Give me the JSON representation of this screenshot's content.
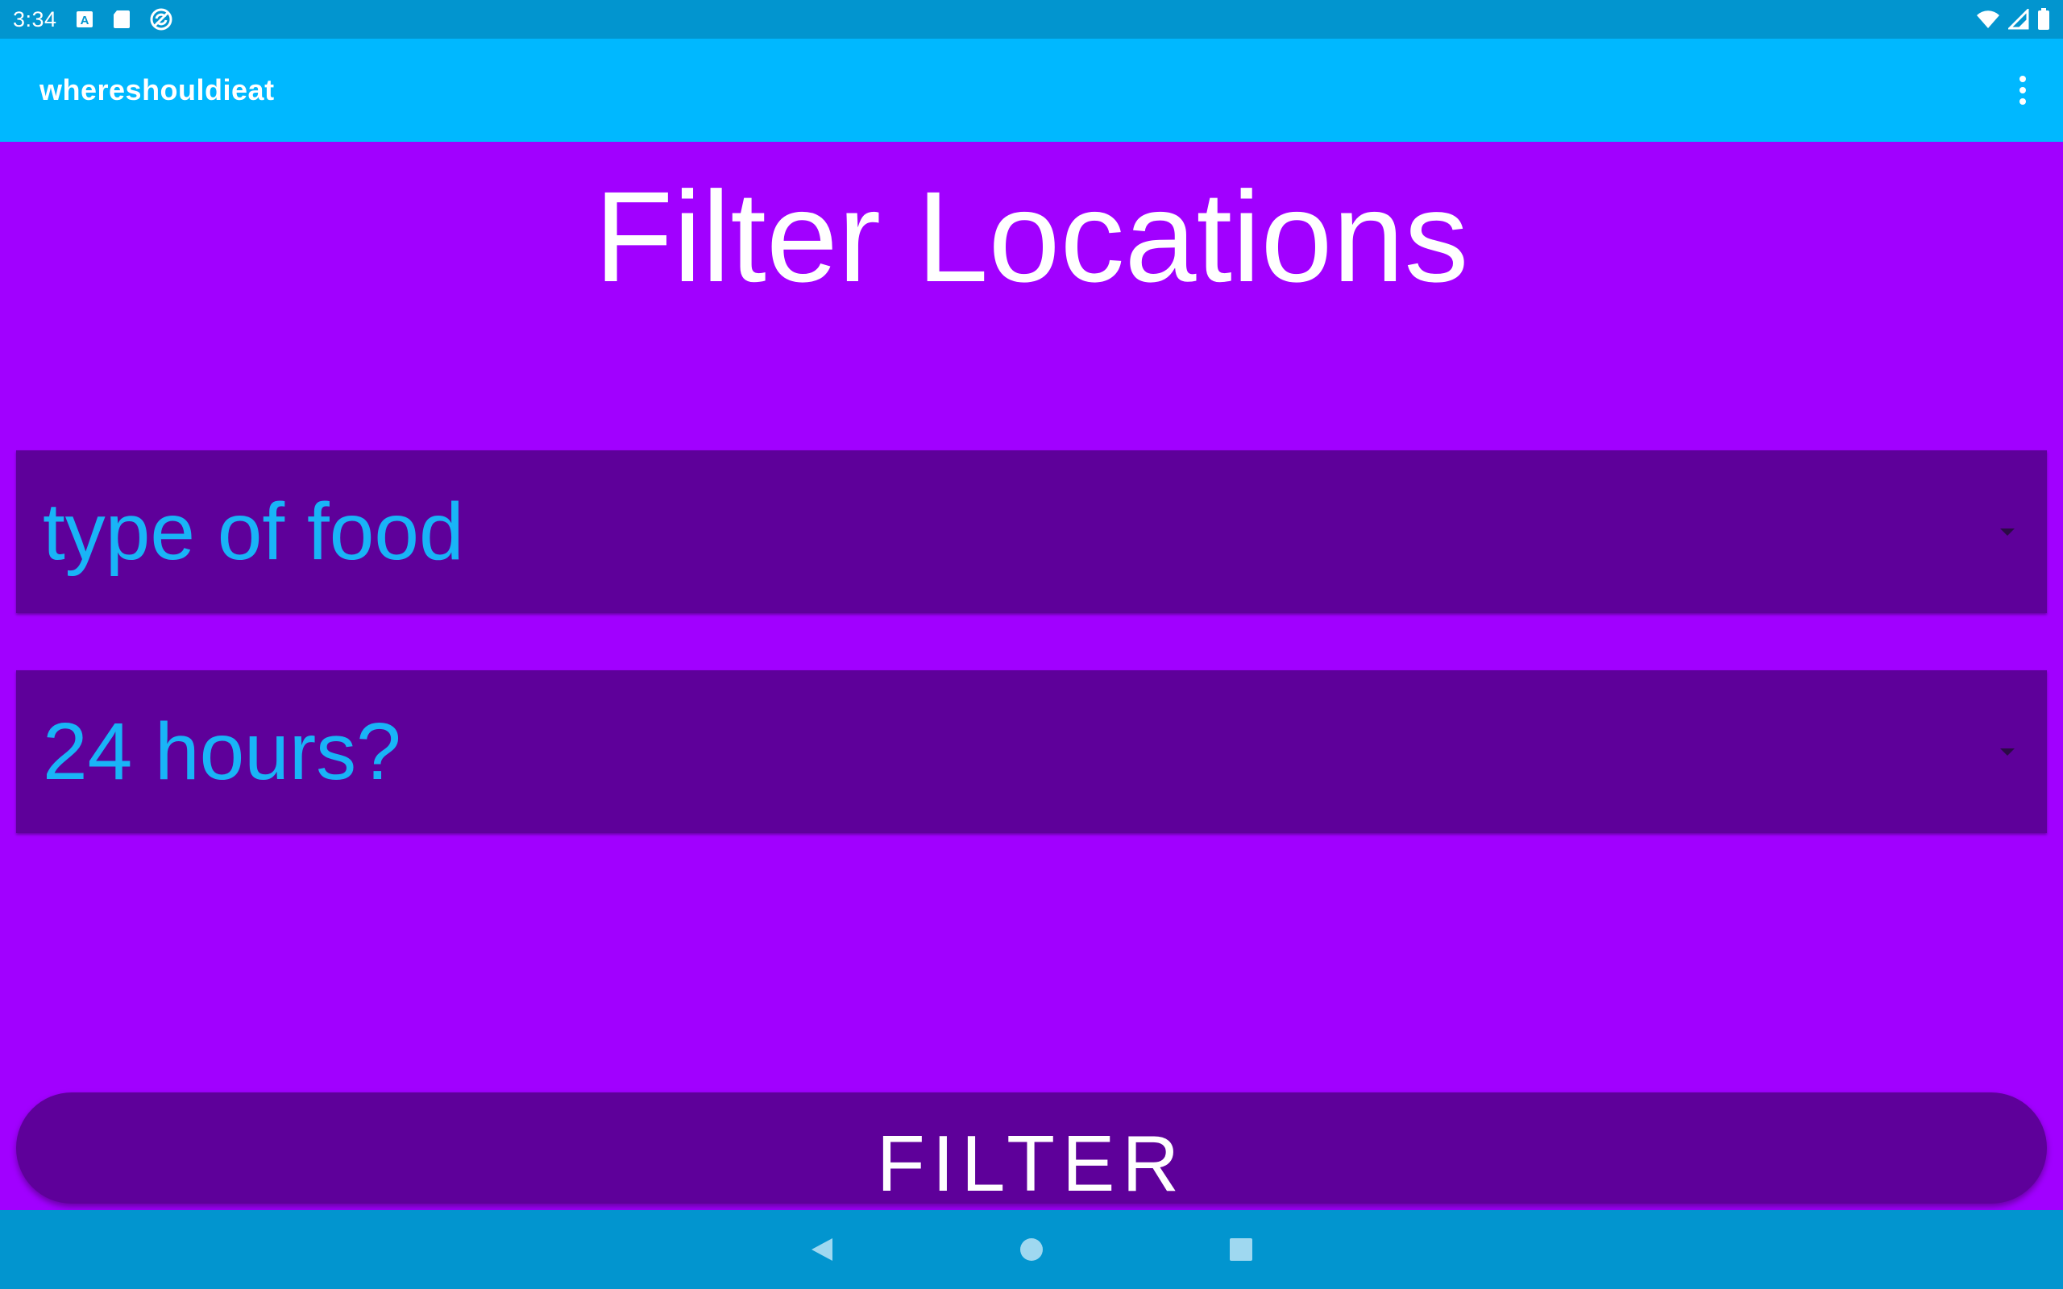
{
  "status_bar": {
    "time": "3:34",
    "icons": [
      "keyboard-a-icon",
      "sd-card-icon",
      "sync-circle-icon"
    ],
    "right_icons": [
      "wifi-icon",
      "signal-icon",
      "battery-icon"
    ]
  },
  "app_bar": {
    "title": "whereshouldieat",
    "overflow_icon": "more-vert-icon"
  },
  "main": {
    "title": "Filter Locations",
    "spinner_food": "type of food",
    "spinner_hours": "24 hours?",
    "filter_label": "FILTER"
  },
  "nav_bar": {
    "buttons": [
      "back-icon",
      "home-icon",
      "recents-icon"
    ]
  },
  "colors": {
    "background": "#a100ff",
    "app_bar": "#00b8ff",
    "system_bars": "#0295cf",
    "spinner_bg": "#5e009a",
    "spinner_text": "#19b4f7"
  }
}
